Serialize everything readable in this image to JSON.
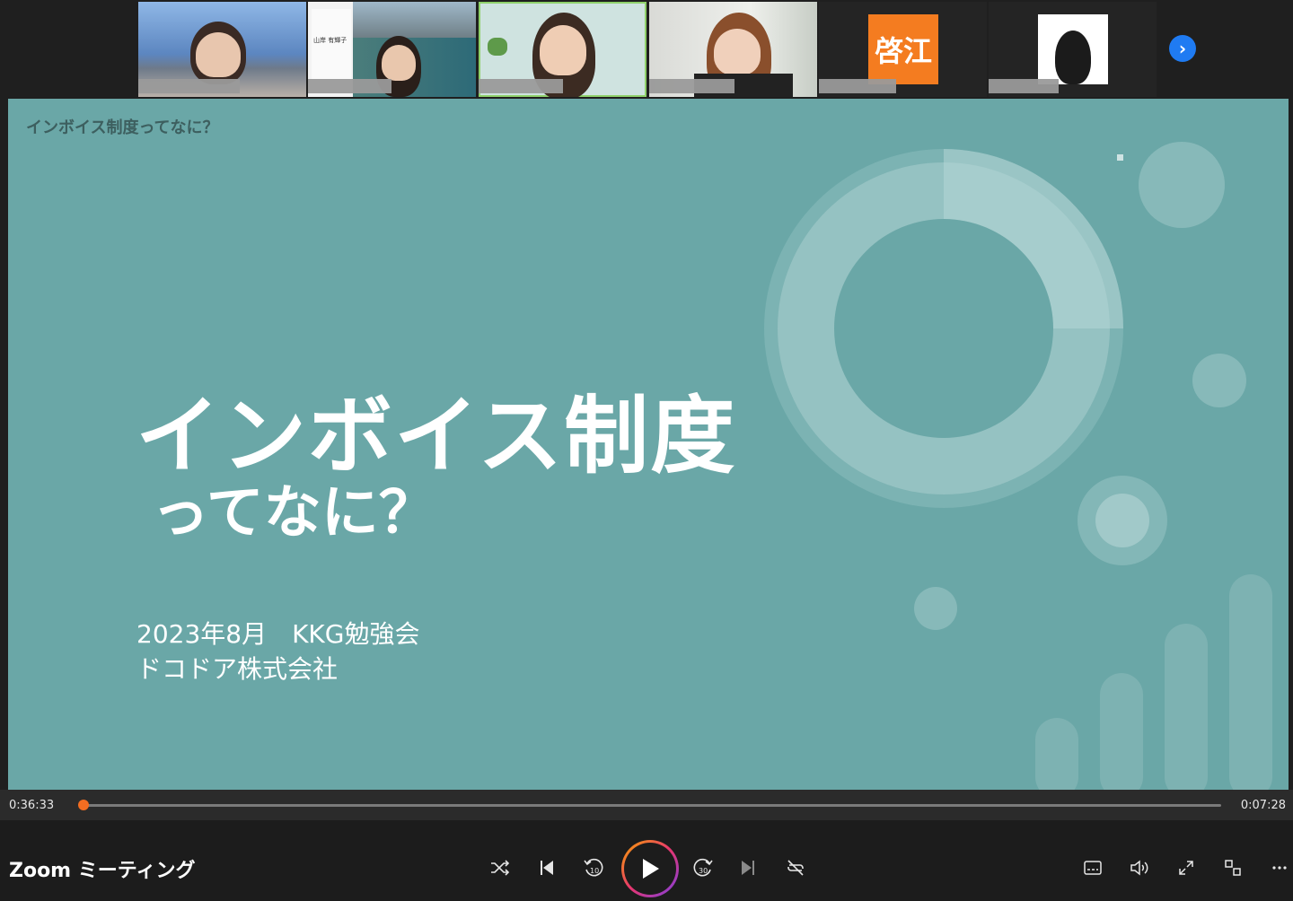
{
  "participants": [
    {
      "id": "p1",
      "type": "video"
    },
    {
      "id": "p2",
      "type": "video",
      "card_name": "山岸 有輝子"
    },
    {
      "id": "p3",
      "type": "video",
      "active": true
    },
    {
      "id": "p4",
      "type": "video"
    },
    {
      "id": "p5",
      "type": "avatar",
      "avatar_text": "啓江",
      "avatar_color": "#f47c20"
    },
    {
      "id": "p6",
      "type": "avatar-photo"
    }
  ],
  "slide": {
    "header": "インボイス制度ってなに？",
    "title": "インボイス制度",
    "subtitle": "ってなに？",
    "date_line": "2023年8月　KKG勉強会",
    "company": "ドコドア株式会社",
    "background": "#6aa7a7"
  },
  "player": {
    "elapsed": "0:36:33",
    "remaining": "0:07:28",
    "progress": 0.0,
    "app_title": "Zoom ミーティング",
    "accent": "#f26d21"
  },
  "icons": {
    "shuffle": "shuffle-icon",
    "previous": "previous-icon",
    "back10": "skip-back-10-icon",
    "play": "play-icon",
    "forward30": "skip-forward-30-icon",
    "next": "next-icon",
    "repeat": "repeat-off-icon",
    "captions": "captions-icon",
    "volume": "volume-icon",
    "fullscreen": "fullscreen-icon",
    "miniplayer": "mini-player-icon",
    "more": "more-icon"
  }
}
